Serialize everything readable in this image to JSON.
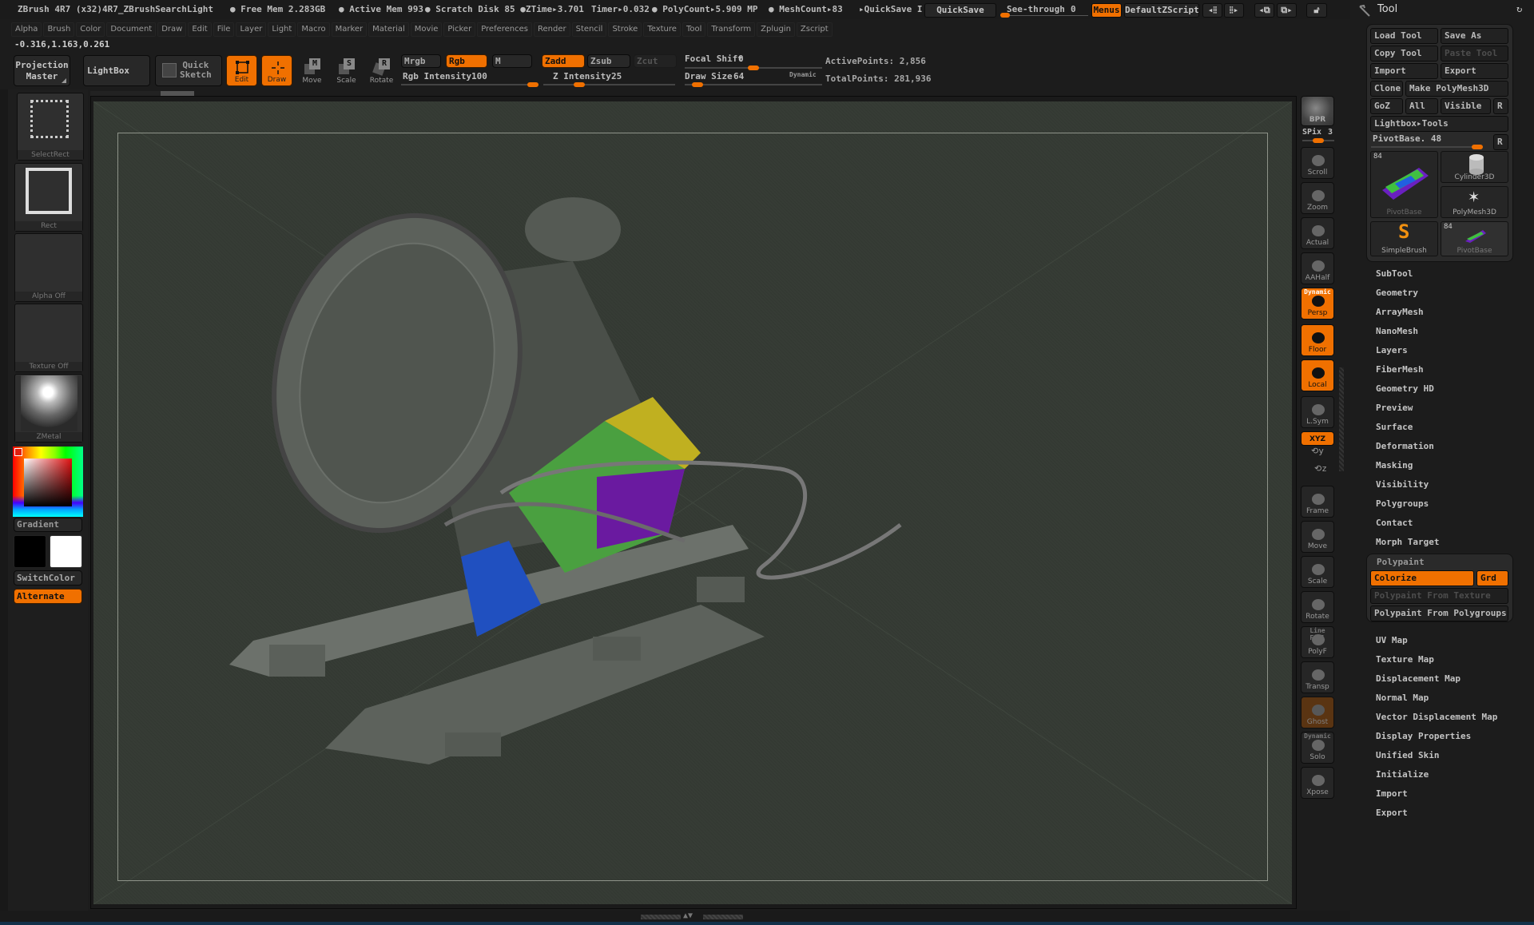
{
  "titlebar": {
    "app_title": "ZBrush 4R7 (x32)4R7_ZBrushSearchLight",
    "free_mem": "● Free Mem 2.283GB",
    "active_mem": "● Active Mem 993",
    "scratch_disk": "● Scratch Disk 85 ●",
    "ztime": "ZTime▸3.701",
    "timer": "Timer▸0.032",
    "polycount": "● PolyCount▸5.909 MP",
    "meshcount": "● MeshCount▸83",
    "quicksave_info": "▸QuickSave I",
    "quicksave_button": "QuickSave",
    "see_through_label": "See-through",
    "see_through_value": "0",
    "see_through_fraction": 0,
    "menus_button": "Menus",
    "zscript_button": "DefaultZScript",
    "icons": [
      "scroll-left-icon",
      "scroll-right-icon",
      "window-left-icon",
      "window-right-icon",
      "lock-icon"
    ]
  },
  "menubar": [
    "Alpha",
    "Brush",
    "Color",
    "Document",
    "Draw",
    "Edit",
    "File",
    "Layer",
    "Light",
    "Macro",
    "Marker",
    "Material",
    "Movie",
    "Picker",
    "Preferences",
    "Render",
    "Stencil",
    "Stroke",
    "Texture",
    "Tool",
    "Transform",
    "Zplugin",
    "Zscript"
  ],
  "coords": "-0.316,1.163,0.261",
  "toolbar": {
    "projection_master": [
      "Projection",
      "Master"
    ],
    "lightbox": "LightBox",
    "quick_sketch": [
      "Quick",
      "Sketch"
    ],
    "edit": "Edit",
    "draw": "Draw",
    "move": "Move",
    "scale": "Scale",
    "rotate": "Rotate",
    "move_key": "M",
    "scale_key": "S",
    "rotate_key": "R",
    "mrgb": "Mrgb",
    "rgb": "Rgb",
    "m": "M",
    "rgb_intensity_label": "Rgb Intensity",
    "rgb_intensity": "100",
    "rgb_intensity_fraction": 1.0,
    "zadd": "Zadd",
    "zsub": "Zsub",
    "zcut": "Zcut",
    "z_intensity_label": "Z Intensity",
    "z_intensity": "25",
    "z_intensity_fraction": 0.25,
    "focal_shift_label": "Focal Shift",
    "focal_shift": "0",
    "focal_shift_fraction": 0.5,
    "draw_size_label": "Draw Size",
    "draw_size": "64",
    "draw_size_fraction": 0.06,
    "dynamic": "Dynamic",
    "active_points": "ActivePoints: 2,856",
    "total_points": "TotalPoints: 281,936"
  },
  "leftshelf": {
    "brush": "SelectRect",
    "stroke": "Rect",
    "alpha": "Alpha  Off",
    "texture": "Texture  Off",
    "material": "ZMetal",
    "gradient": "Gradient",
    "switch_color": "SwitchColor",
    "alternate": "Alternate",
    "main_color": "#000000",
    "secondary_color": "#ffffff",
    "picked_color": "#e02010"
  },
  "rightshelf": {
    "bpr": "BPR",
    "spix_label": "SPix",
    "spix": "3",
    "buttons": [
      {
        "label": "Scroll",
        "active": false
      },
      {
        "label": "Zoom",
        "active": false
      },
      {
        "label": "Actual",
        "active": false
      },
      {
        "label": "AAHalf",
        "active": false
      },
      {
        "label": "Persp",
        "active": true,
        "top": "Dynamic"
      },
      {
        "label": "Floor",
        "active": true
      },
      {
        "label": "Local",
        "active": true
      },
      {
        "label": "L.Sym",
        "active": false
      },
      {
        "label": "XYZ",
        "active": true
      },
      {
        "label": "Frame",
        "active": false
      },
      {
        "label": "Move",
        "active": false
      },
      {
        "label": "Scale",
        "active": false
      },
      {
        "label": "Rotate",
        "active": false
      },
      {
        "label": "PolyF",
        "active": false,
        "top": "Line Fill"
      },
      {
        "label": "Transp",
        "active": false
      },
      {
        "label": "Ghost",
        "active": false
      },
      {
        "label": "Solo",
        "active": false,
        "top": "Dynamic"
      },
      {
        "label": "Xpose",
        "active": false
      }
    ]
  },
  "toolpanel": {
    "title": "Tool",
    "load_tool": "Load Tool",
    "save_as": "Save As",
    "copy_tool": "Copy Tool",
    "paste_tool": "Paste Tool",
    "import": "Import",
    "export": "Export",
    "clone": "Clone",
    "make_polymesh": "Make PolyMesh3D",
    "goz": "GoZ",
    "all": "All",
    "visible": "Visible",
    "r": "R",
    "lightbox_tools": "Lightbox▸Tools",
    "pivot_label": "PivotBase. 48",
    "pivot_fraction": 1.0,
    "tools": [
      {
        "name": "PivotBase",
        "count": "84"
      },
      {
        "name": "Cylinder3D"
      },
      {
        "name": "PolyMesh3D"
      },
      {
        "name": "SimpleBrush"
      },
      {
        "name": "PivotBase",
        "count": "84"
      }
    ],
    "subpalettes_top": [
      "SubTool",
      "Geometry",
      "ArrayMesh",
      "NanoMesh",
      "Layers",
      "FiberMesh",
      "Geometry HD",
      "Preview",
      "Surface",
      "Deformation",
      "Masking",
      "Visibility",
      "Polygroups",
      "Contact",
      "Morph Target"
    ],
    "polypaint": {
      "title": "Polypaint",
      "colorize": "Colorize",
      "grd": "Grd",
      "from_texture": "Polypaint From Texture",
      "from_polygroups": "Polypaint From Polygroups"
    },
    "subpalettes_bottom": [
      "UV Map",
      "Texture Map",
      "Displacement Map",
      "Normal Map",
      "Vector Displacement Map",
      "Display Properties",
      "Unified Skin",
      "Initialize",
      "Import",
      "Export"
    ]
  },
  "colors": {
    "accent": "#f07000",
    "canvas": "#363c35",
    "panel": "#1c1c1c"
  }
}
